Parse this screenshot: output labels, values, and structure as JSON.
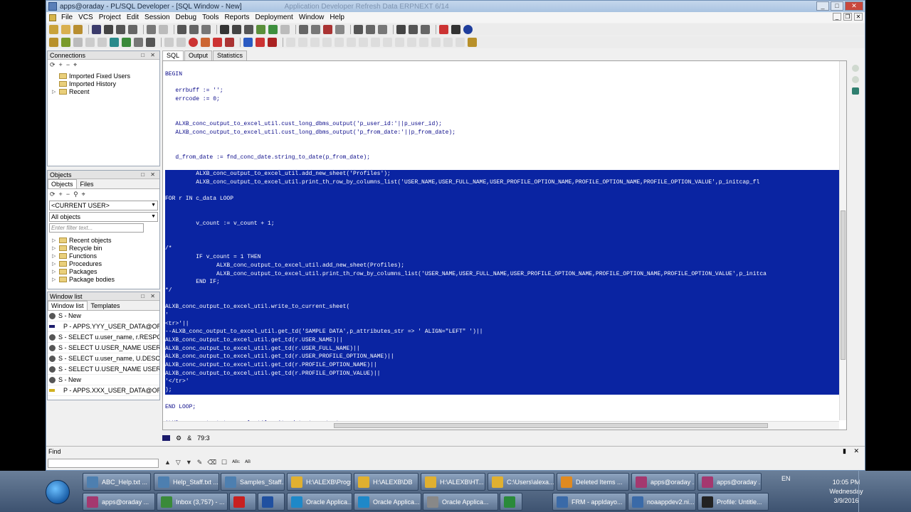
{
  "window": {
    "title": "apps@oraday - PL/SQL Developer - [SQL Window - New]",
    "title_blur": "Application Developer Refresh Data ERPNEXT 6/14"
  },
  "menu": [
    "File",
    "VCS",
    "Project",
    "Edit",
    "Session",
    "Debug",
    "Tools",
    "Reports",
    "Deployment",
    "Window",
    "Help"
  ],
  "connections": {
    "title": "Connections",
    "items": [
      "Imported Fixed Users",
      "Imported History",
      "Recent"
    ]
  },
  "objects": {
    "title": "Objects",
    "tabs": [
      "Objects",
      "Files"
    ],
    "user_combo": "<CURRENT USER>",
    "filter_combo": "All objects",
    "filter_placeholder": "Enter filter text...",
    "items": [
      "Recent objects",
      "Recycle bin",
      "Functions",
      "Procedures",
      "Packages",
      "Package bodies"
    ]
  },
  "window_list": {
    "title": "Window list",
    "tabs": [
      "Window list",
      "Templates"
    ],
    "items": [
      {
        "kind": "s",
        "label": "S - New"
      },
      {
        "kind": "p",
        "label": "P - APPS.YYY_USER_DATA@ORADAY"
      },
      {
        "kind": "s",
        "label": "S - SELECT u.user_name, r.RESPONSIE"
      },
      {
        "kind": "s",
        "label": "S - SELECT U.USER_NAME USER_NAM"
      },
      {
        "kind": "s",
        "label": "S - SELECT u.user_name, U.DESCRIPT"
      },
      {
        "kind": "s",
        "label": "S - SELECT U.USER_NAME USER_NAM"
      },
      {
        "kind": "s",
        "label": "S - New"
      },
      {
        "kind": "p",
        "label": "P - APPS.XXX_USER_DATA@ORADAY"
      }
    ]
  },
  "editor": {
    "tabs": [
      "SQL",
      "Output",
      "Statistics"
    ],
    "lines": [
      {
        "t": "BEGIN",
        "s": false
      },
      {
        "t": "",
        "s": false
      },
      {
        "t": "   errbuff := '';",
        "s": false
      },
      {
        "t": "   errcode := 0;",
        "s": false
      },
      {
        "t": "",
        "s": false
      },
      {
        "t": "",
        "s": false
      },
      {
        "t": "   ALXB_conc_output_to_excel_util.cust_long_dbms_output('p_user_id:'||p_user_id);",
        "s": false
      },
      {
        "t": "   ALXB_conc_output_to_excel_util.cust_long_dbms_output('p_from_date:'||p_from_date);",
        "s": false
      },
      {
        "t": "",
        "s": false
      },
      {
        "t": "",
        "s": false
      },
      {
        "t": "   d_from_date := fnd_conc_date.string_to_date(p_from_date);",
        "s": false
      },
      {
        "t": "",
        "s": false
      },
      {
        "t": "         ALXB_conc_output_to_excel_util.add_new_sheet('Profiles');",
        "s": true
      },
      {
        "t": "         ALXB_conc_output_to_excel_util.print_th_row_by_columns_list('USER_NAME,USER_FULL_NAME,USER_PROFILE_OPTION_NAME,PROFILE_OPTION_NAME,PROFILE_OPTION_VALUE',p_initcap_fl",
        "s": true
      },
      {
        "t": "",
        "s": true
      },
      {
        "t": "FOR r IN c_data LOOP",
        "s": true
      },
      {
        "t": "",
        "s": true
      },
      {
        "t": "",
        "s": true
      },
      {
        "t": "         v_count := v_count + 1;",
        "s": true
      },
      {
        "t": "",
        "s": true
      },
      {
        "t": "",
        "s": true
      },
      {
        "t": "/*",
        "s": true
      },
      {
        "t": "         IF v_count = 1 THEN",
        "s": true
      },
      {
        "t": "               ALXB_conc_output_to_excel_util.add_new_sheet(Profiles);",
        "s": true
      },
      {
        "t": "               ALXB_conc_output_to_excel_util.print_th_row_by_columns_list('USER_NAME,USER_FULL_NAME,USER_PROFILE_OPTION_NAME,PROFILE_OPTION_NAME,PROFILE_OPTION_VALUE',p_initca",
        "s": true
      },
      {
        "t": "         END IF;",
        "s": true
      },
      {
        "t": "*/",
        "s": true
      },
      {
        "t": "",
        "s": true
      },
      {
        "t": "ALXB_conc_output_to_excel_util.write_to_current_sheet(",
        "s": true
      },
      {
        "t": "'",
        "s": true
      },
      {
        "t": "<tr>'||",
        "s": true
      },
      {
        "t": "--ALXB_conc_output_to_excel_util.get_td('SAMPLE DATA',p_attributes_str => ' ALIGN=\"LEFT\" ')||",
        "s": true
      },
      {
        "t": "ALXB_conc_output_to_excel_util.get_td(r.USER_NAME)||",
        "s": true
      },
      {
        "t": "ALXB_conc_output_to_excel_util.get_td(r.USER_FULL_NAME)||",
        "s": true
      },
      {
        "t": "ALXB_conc_output_to_excel_util.get_td(r.USER_PROFILE_OPTION_NAME)||",
        "s": true
      },
      {
        "t": "ALXB_conc_output_to_excel_util.get_td(r.PROFILE_OPTION_NAME)||",
        "s": true
      },
      {
        "t": "ALXB_conc_output_to_excel_util.get_td(r.PROFILE_OPTION_VALUE)||",
        "s": true
      },
      {
        "t": "'</tr>'",
        "s": true
      },
      {
        "t": ");",
        "s": true
      },
      {
        "t": "",
        "s": false
      },
      {
        "t": "END LOOP;",
        "s": false
      },
      {
        "t": "",
        "s": false
      },
      {
        "t": "ALXB_conc_output_to_excel_util.write_data_to_output;",
        "s": false
      }
    ]
  },
  "status": {
    "position": "79:3"
  },
  "find": {
    "label": "Find"
  },
  "taskbar": {
    "row1": [
      "ABC_Help.txt ...",
      "Help_Staff.txt ...",
      "Samples_Staff...",
      "H:\\ALEXB\\Progs",
      "H:\\ALEXB\\DB",
      "H:\\ALEXB\\HT...",
      "C:\\Users\\alexa...",
      "Deleted Items ...",
      "apps@oraday ...",
      "apps@oraday ..."
    ],
    "row2": [
      "apps@oraday ...",
      "Inbox (3,757) - ...",
      "",
      "",
      "Oracle Applica...",
      "Oracle Applica...",
      "Oracle Applica...",
      "",
      "FRM - appldayo...",
      "noaappdev2.ni...",
      "Profile: Untitle..."
    ],
    "lang": "EN",
    "time": "10:05 PM",
    "day": "Wednesday",
    "date": "3/9/2016"
  },
  "colors": {
    "selection": "#0a24a2",
    "code_text": "#0b0b8a"
  }
}
